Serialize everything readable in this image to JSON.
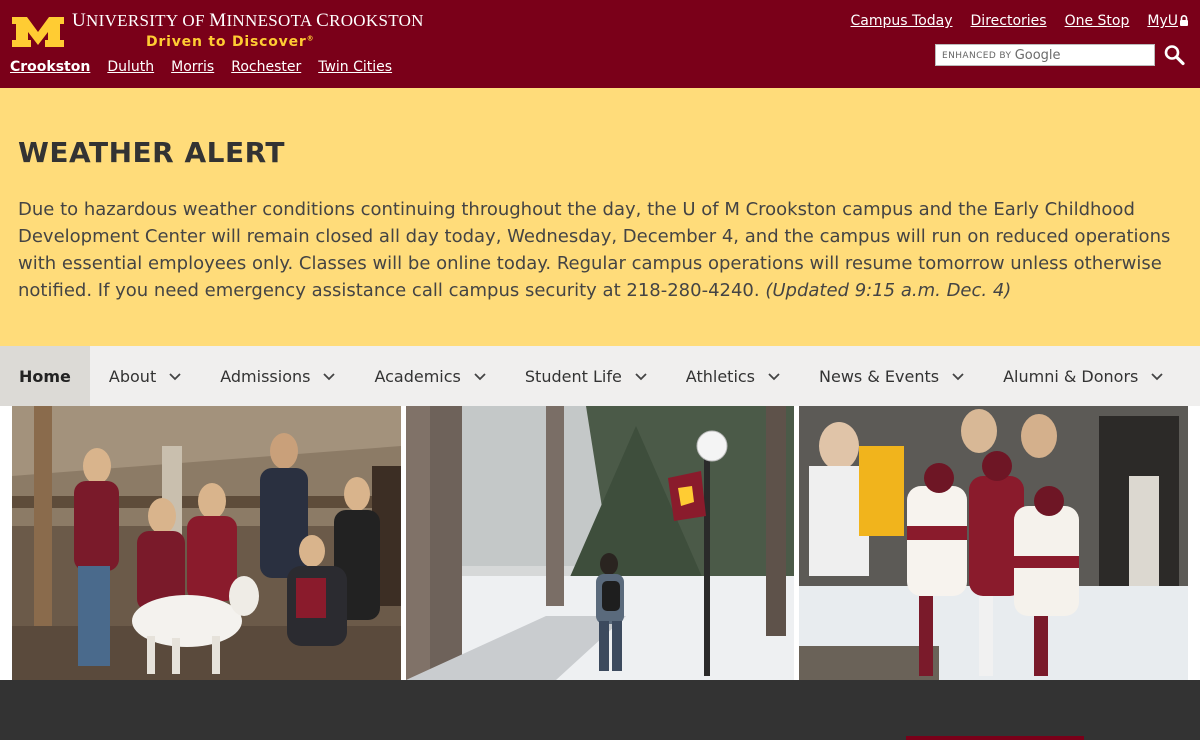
{
  "header": {
    "university_prefix": "U",
    "university_rest": "NIVERSITY OF ",
    "minnesota_prefix": "M",
    "minnesota_rest": "INNESOTA ",
    "crookston_prefix": "C",
    "crookston_rest": "ROOKSTON",
    "tagline": "Driven to Discover",
    "tagline_mark": "®",
    "campus_links": [
      "Crookston",
      "Duluth",
      "Morris",
      "Rochester",
      "Twin Cities"
    ],
    "utility_links": [
      "Campus Today",
      "Directories",
      "One Stop",
      "MyU"
    ],
    "search": {
      "enhanced_by": "ENHANCED BY",
      "brand": "Google",
      "placeholder": ""
    },
    "icons": {
      "logo": "block-m-logo",
      "search": "search-icon",
      "lock": "lock-icon"
    }
  },
  "alert": {
    "title": "WEATHER ALERT",
    "body": "Due to hazardous weather conditions continuing throughout the day, the U of M Crookston campus and the Early Childhood Development Center will remain closed all day today, Wednesday, December 4, and the campus will run on reduced operations with essential employees only. Classes will be online today. Regular campus operations will resume tomorrow unless otherwise notified. If you need emergency assistance call campus security at 218-280-4240.",
    "updated": "(Updated 9:15 a.m. Dec. 4)"
  },
  "nav": {
    "items": [
      {
        "label": "Home",
        "active": true,
        "dropdown": false
      },
      {
        "label": "About",
        "active": false,
        "dropdown": true
      },
      {
        "label": "Admissions",
        "active": false,
        "dropdown": true
      },
      {
        "label": "Academics",
        "active": false,
        "dropdown": true
      },
      {
        "label": "Student Life",
        "active": false,
        "dropdown": true
      },
      {
        "label": "Athletics",
        "active": false,
        "dropdown": true
      },
      {
        "label": "News & Events",
        "active": false,
        "dropdown": true
      },
      {
        "label": "Alumni & Donors",
        "active": false,
        "dropdown": true
      }
    ]
  },
  "photos": [
    "students-with-goat-photo",
    "campus-winter-walk-photo",
    "hockey-celebration-photo"
  ],
  "colors": {
    "maroon": "#7a0019",
    "gold": "#ffcc33",
    "alert_bg": "#ffdc7a",
    "nav_bg": "#f0efee",
    "nav_active": "#dcdad6",
    "footer": "#333333"
  }
}
